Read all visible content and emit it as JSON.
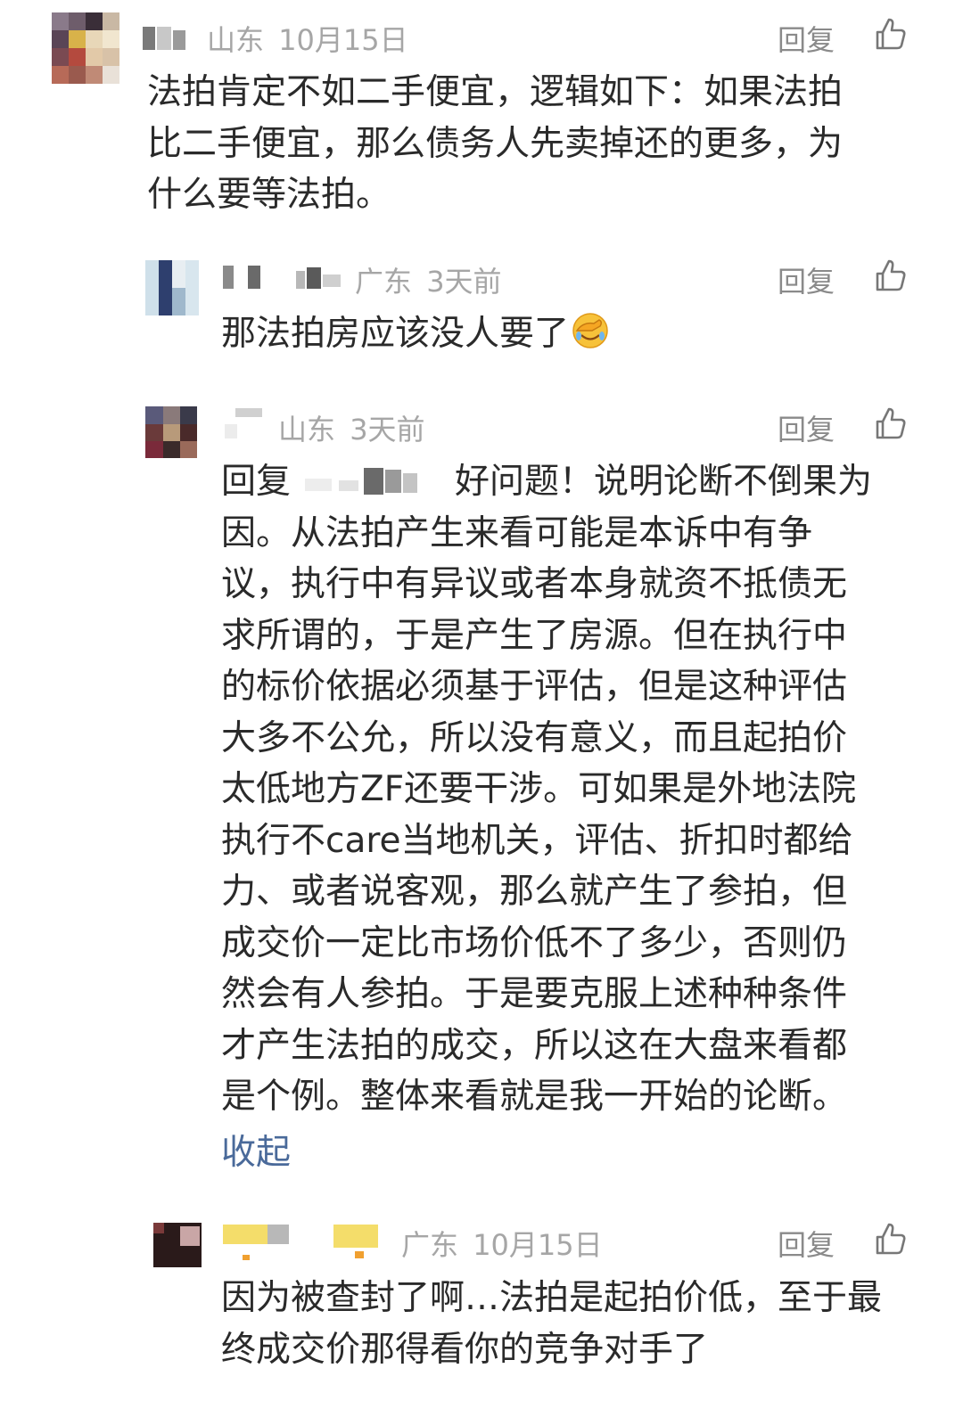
{
  "comments": [
    {
      "location": "山东",
      "time": "10月15日",
      "reply_label": "回复",
      "lines": [
        "法拍肯定不如二手便宜，逻辑如下：如果法拍",
        "比二手便宜，那么债务人先卖掉还的更多，为",
        "什么要等法拍。"
      ]
    },
    {
      "location": "广东",
      "time": "3天前",
      "reply_label": "回复",
      "text": "那法拍房应该没人要了",
      "emoji": "facepalm-emoji"
    },
    {
      "location": "山东",
      "time": "3天前",
      "reply_label": "回复",
      "reply_prefix": "回复",
      "first_line_rest": "好问题！说明论断不倒果为",
      "lines": [
        "因。从法拍产生来看可能是本诉中有争",
        "议，执行中有异议或者本身就资不抵债无",
        "求所谓的，于是产生了房源。但在执行中",
        "的标价依据必须基于评估，但是这种评估",
        "大多不公允，所以没有意义，而且起拍价",
        "太低地方ZF还要干涉。可如果是外地法院",
        "执行不care当地机关，评估、折扣时都给",
        "力、或者说客观，那么就产生了参拍，但",
        "成交价一定比市场价低不了多少，否则仍",
        "然会有人参拍。于是要克服上述种种条件",
        "才产生法拍的成交，所以这在大盘来看都",
        "是个例。整体来看就是我一开始的论断。"
      ],
      "collapse_label": "收起"
    },
    {
      "location": "广东",
      "time": "10月15日",
      "reply_label": "回复",
      "lines": [
        "因为被查封了啊…法拍是起拍价低，至于最",
        "终成交价那得看你的竞争对手了"
      ]
    }
  ],
  "icons": {
    "like": "thumbs-up-icon"
  },
  "colors": {
    "meta": "#a6a6a6",
    "link": "#4a6a9a",
    "text": "#2a2a2a"
  }
}
